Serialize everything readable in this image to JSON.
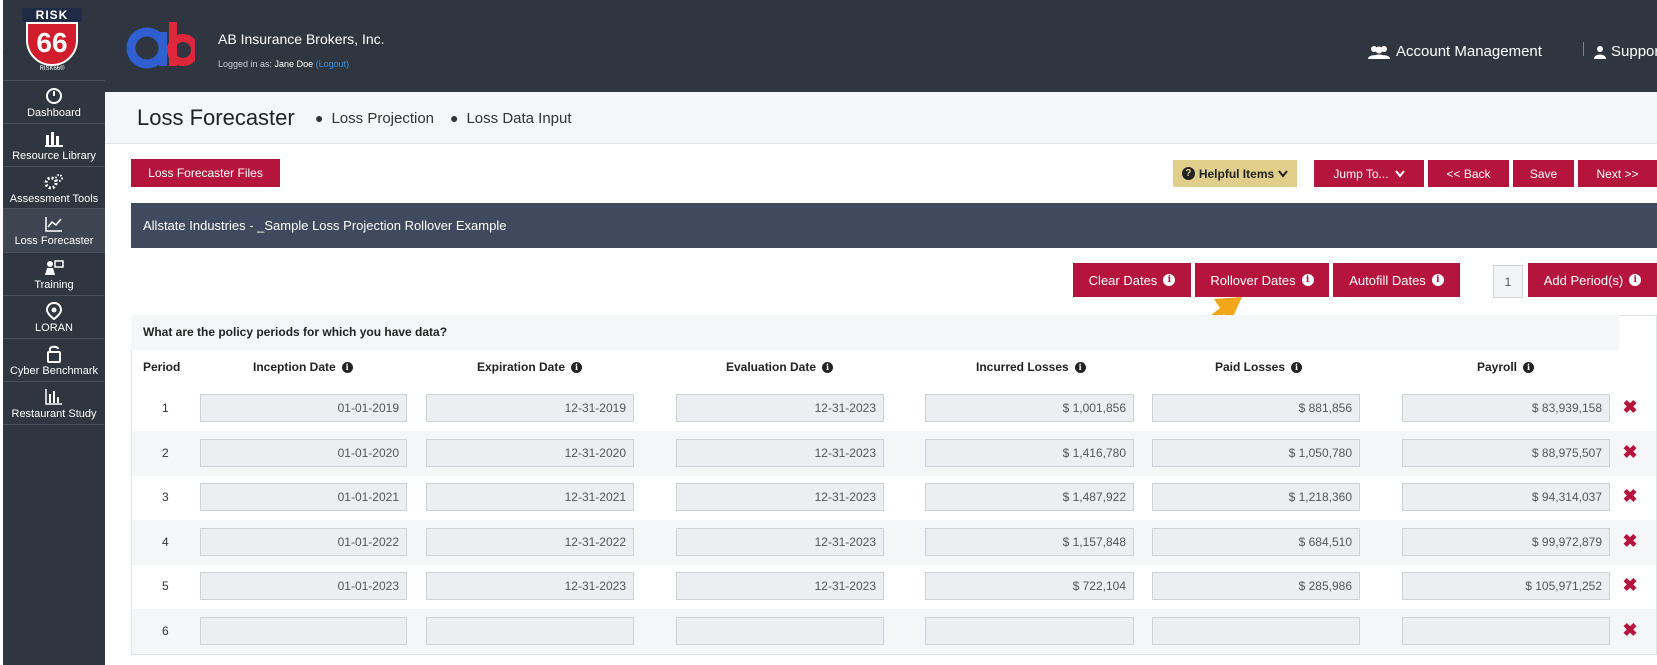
{
  "sidebar": {
    "logo_top": "RISK",
    "logo_number": "66",
    "logo_sub": "RISK66®",
    "stray_char": "r",
    "items": [
      {
        "label": "Dashboard",
        "icon": "dashboard-icon"
      },
      {
        "label": "Resource Library",
        "icon": "library-icon"
      },
      {
        "label": "Assessment Tools",
        "icon": "gears-icon"
      },
      {
        "label": "Loss Forecaster",
        "icon": "line-chart-icon"
      },
      {
        "label": "Training",
        "icon": "training-icon"
      },
      {
        "label": "LORAN",
        "icon": "loran-icon"
      },
      {
        "label": "Cyber Benchmark",
        "icon": "cyber-icon"
      },
      {
        "label": "Restaurant Study",
        "icon": "bar-chart-icon"
      }
    ]
  },
  "header": {
    "company": "AB Insurance Brokers, Inc.",
    "logged_in_prefix": "Logged in as: ",
    "user": "Jane Doe",
    "logout": "(Logout)",
    "account_management": "Account Management",
    "support": "Support"
  },
  "titlebar": {
    "title": "Loss Forecaster",
    "crumbs": [
      "Loss Projection",
      "Loss Data Input"
    ]
  },
  "toolbar": {
    "files": "Loss Forecaster Files",
    "helpful": "Helpful Items",
    "jump": "Jump To...",
    "back": "<< Back",
    "save": "Save",
    "next": "Next >>"
  },
  "section": {
    "title": "Allstate Industries - _Sample Loss Projection Rollover Example"
  },
  "actions": {
    "clear": "Clear Dates",
    "rollover": "Rollover Dates",
    "autofill": "Autofill Dates",
    "period_count": "1",
    "add": "Add Period(s)"
  },
  "table": {
    "question": "What are the policy periods for which you have data?",
    "headers": [
      "Period",
      "Inception Date",
      "Expiration Date",
      "Evaluation Date",
      "Incurred Losses",
      "Paid Losses",
      "Payroll"
    ],
    "rows": [
      [
        "1",
        "01-01-2019",
        "12-31-2019",
        "12-31-2023",
        "$ 1,001,856",
        "$ 881,856",
        "$ 83,939,158"
      ],
      [
        "2",
        "01-01-2020",
        "12-31-2020",
        "12-31-2023",
        "$ 1,416,780",
        "$ 1,050,780",
        "$ 88,975,507"
      ],
      [
        "3",
        "01-01-2021",
        "12-31-2021",
        "12-31-2023",
        "$ 1,487,922",
        "$ 1,218,360",
        "$ 94,314,037"
      ],
      [
        "4",
        "01-01-2022",
        "12-31-2022",
        "12-31-2023",
        "$ 1,157,848",
        "$ 684,510",
        "$ 99,972,879"
      ],
      [
        "5",
        "01-01-2023",
        "12-31-2023",
        "12-31-2023",
        "$ 722,104",
        "$ 285,986",
        "$ 105,971,252"
      ],
      [
        "6",
        "",
        "",
        "",
        "",
        "",
        ""
      ]
    ]
  },
  "colors": {
    "sidebar": "#2f3640",
    "accent": "#b5143c",
    "section": "#3f4a5f",
    "helpful": "#e0cf8a",
    "arrow": "#f2a71b"
  }
}
